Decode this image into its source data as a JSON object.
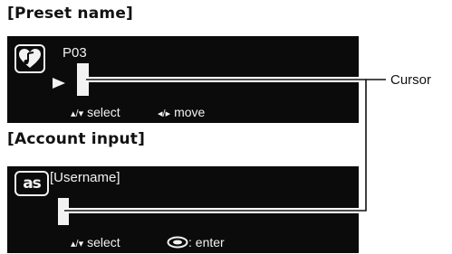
{
  "sections": {
    "preset": {
      "heading": "[Preset name]",
      "name_value": "P03",
      "hint_select": "select",
      "hint_move": "move",
      "hint_select_symbol": "▴/▾",
      "hint_move_symbol": "◂/▸"
    },
    "account": {
      "heading": "[Account input]",
      "username_value": "[Username]",
      "icon_text": "as",
      "hint_select": "select",
      "hint_enter": ": enter",
      "hint_select_symbol": "▴/▾"
    }
  },
  "annotation": {
    "cursor_label": "Cursor"
  },
  "icons": {
    "preset_icon": "heart-music-note-icon",
    "account_icon": "lastfm-icon",
    "play_indicator": "play-arrow-icon",
    "enter_button": "enter-button-icon"
  },
  "colors": {
    "screen_background": "#0b0b0b",
    "screen_text": "#f2f2f2",
    "page_background": "#ffffff"
  }
}
